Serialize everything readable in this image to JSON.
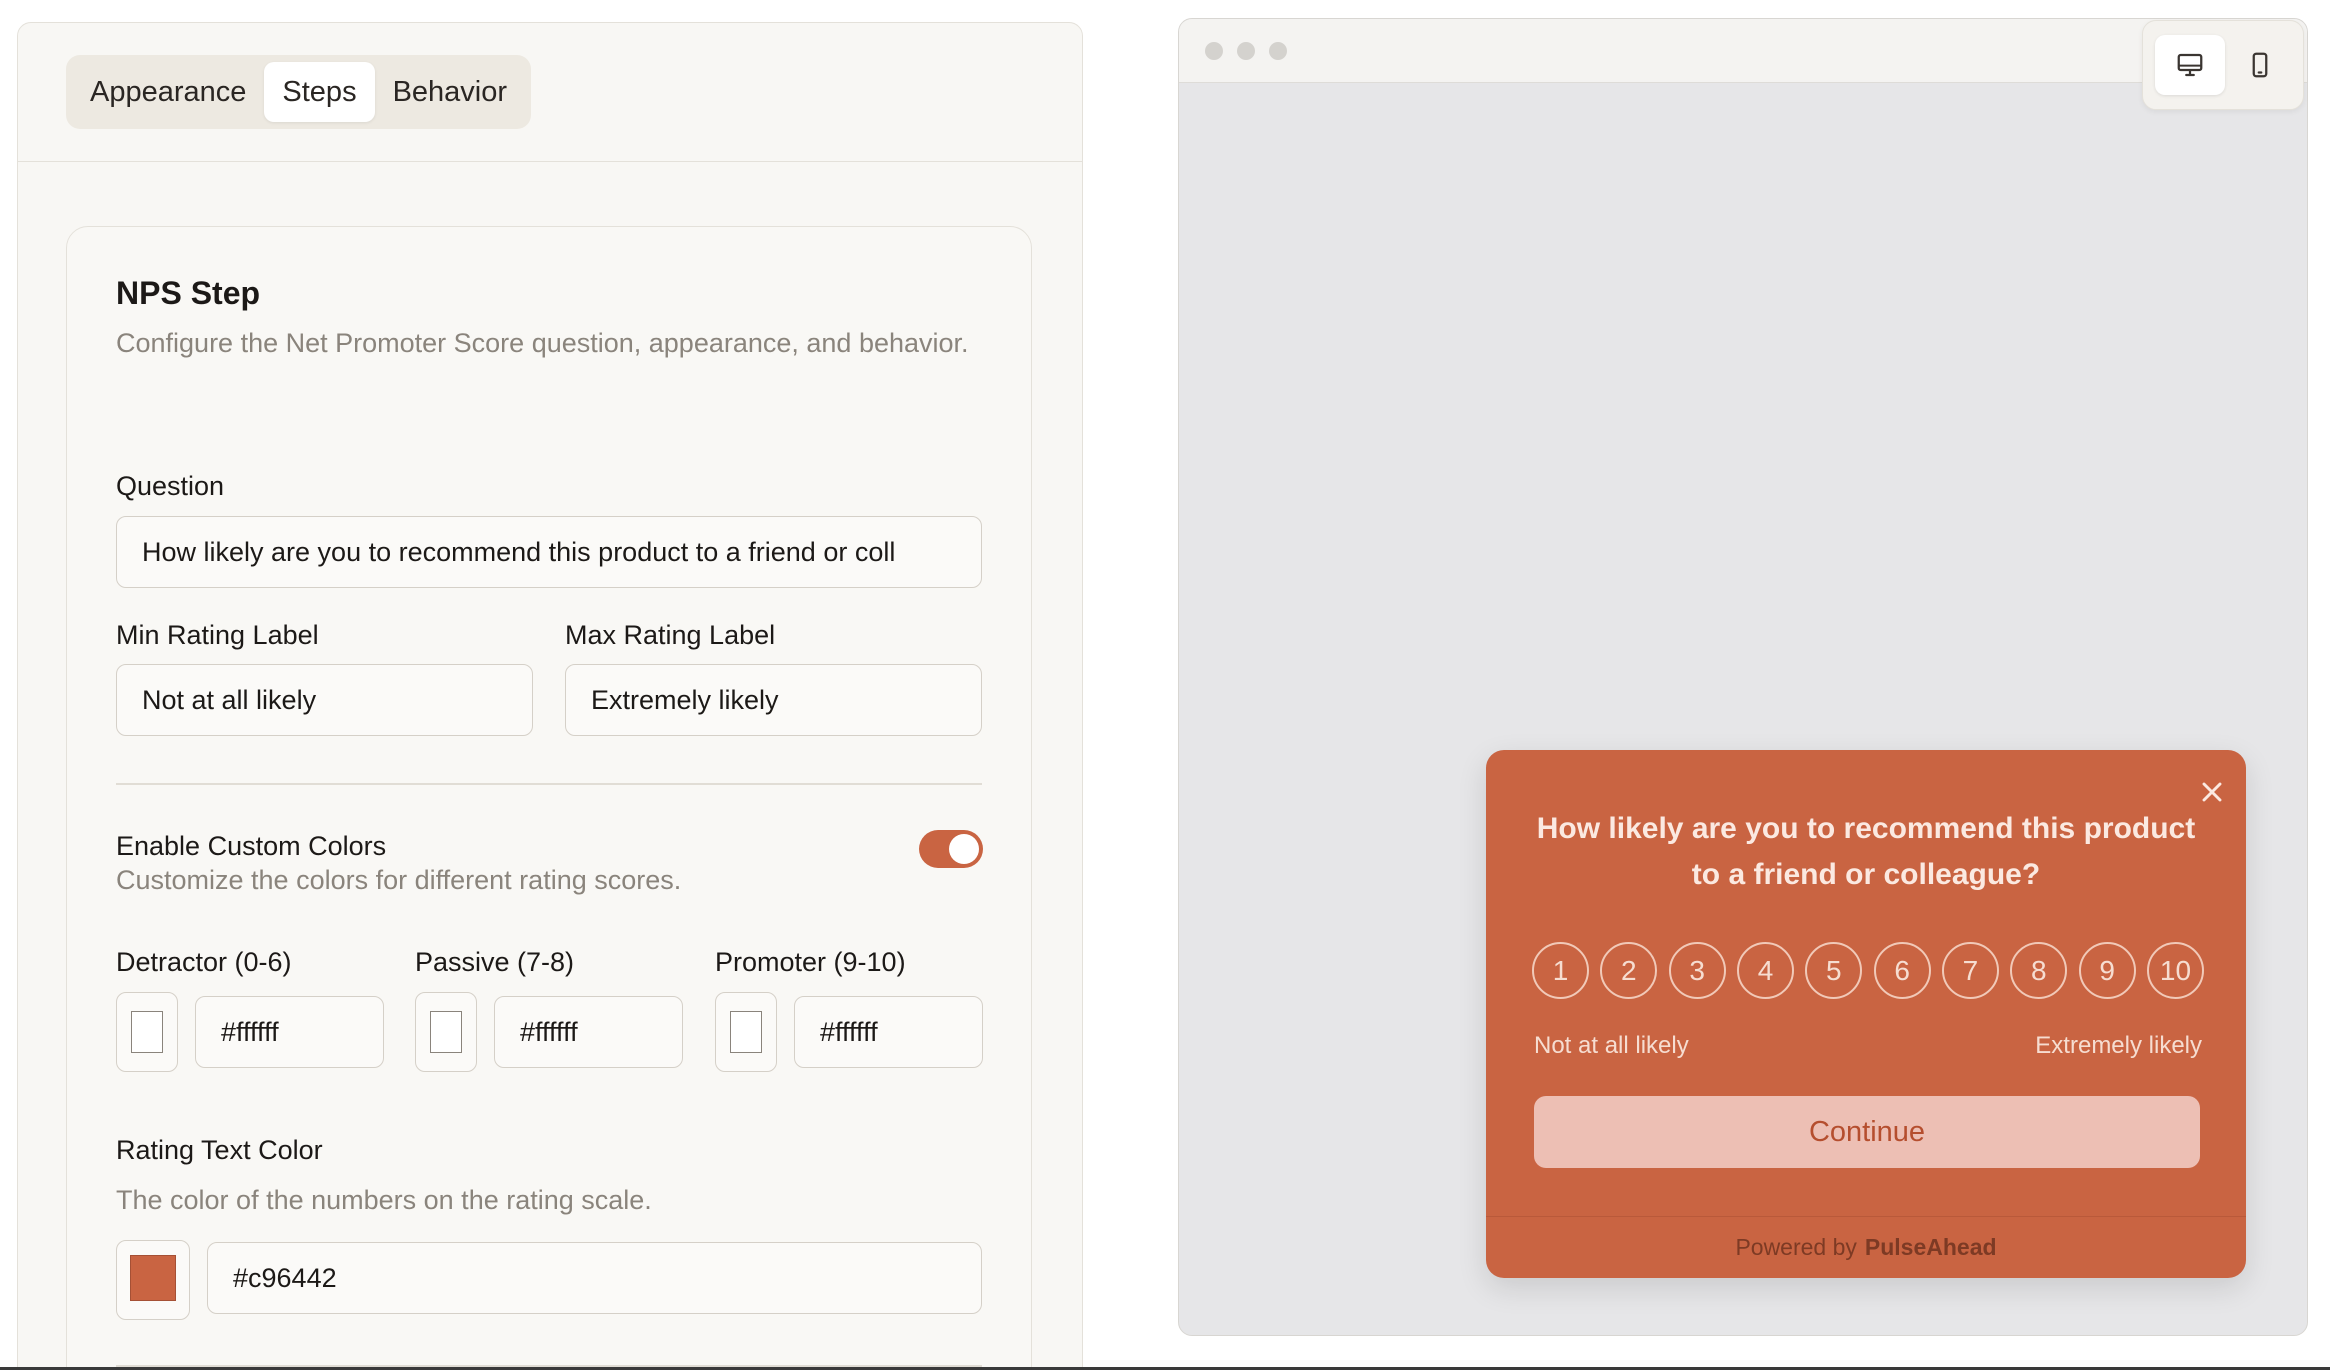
{
  "tabs": [
    {
      "label": "Appearance"
    },
    {
      "label": "Steps"
    },
    {
      "label": "Behavior"
    }
  ],
  "nps_step": {
    "title": "NPS Step",
    "description": "Configure the Net Promoter Score question, appearance, and behavior.",
    "question_label": "Question",
    "question_value": "How likely are you to recommend this product to a friend or coll",
    "min_label": "Min Rating Label",
    "min_value": "Not at all likely",
    "max_label": "Max Rating Label",
    "max_value": "Extremely likely",
    "custom_colors_title": "Enable Custom Colors",
    "custom_colors_desc": "Customize the colors for different rating scores.",
    "custom_colors_enabled": true,
    "detractor_label": "Detractor (0-6)",
    "detractor_value": "#ffffff",
    "passive_label": "Passive (7-8)",
    "passive_value": "#ffffff",
    "promoter_label": "Promoter (9-10)",
    "promoter_value": "#ffffff",
    "rating_text_color_label": "Rating Text Color",
    "rating_text_color_desc": "The color of the numbers on the rating scale.",
    "rating_text_color_value": "#c96442"
  },
  "preview": {
    "device_icons": [
      "desktop-icon",
      "mobile-icon"
    ],
    "widget": {
      "question": "How likely are you to recommend this product to a friend or colleague?",
      "scale": [
        "1",
        "2",
        "3",
        "4",
        "5",
        "6",
        "7",
        "8",
        "9",
        "10"
      ],
      "min_label": "Not at all likely",
      "max_label": "Extremely likely",
      "continue_label": "Continue",
      "powered_by": "Powered by",
      "brand": "PulseAhead",
      "bg_color": "#c96442"
    }
  }
}
